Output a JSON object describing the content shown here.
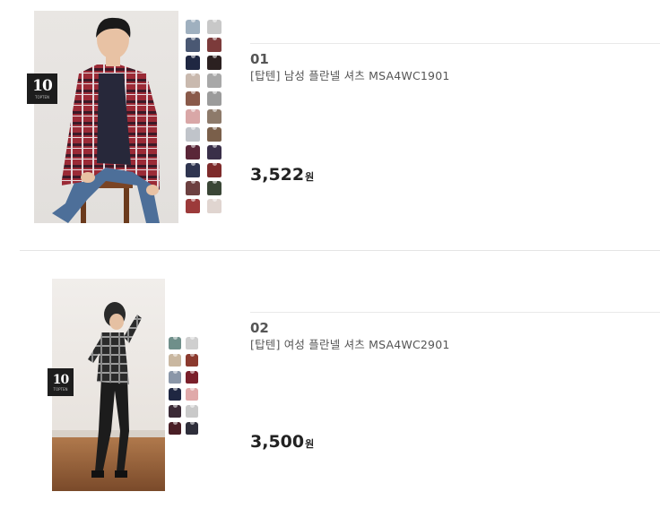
{
  "products": [
    {
      "rank": "01",
      "title": "[탑텐] 남성 플란넬 셔츠 MSA4WC1901",
      "price": "3,522",
      "currency": "원",
      "badge": {
        "number": "10",
        "sub": "TOPTEN"
      },
      "swatch_colors": [
        "#9fb0bf",
        "#c8c8c8",
        "#4a5873",
        "#7c3b3b",
        "#1f2742",
        "#2b2020",
        "#c9b9ae",
        "#a8a8a8",
        "#8a5a4a",
        "#9b9b9b",
        "#d9a7a7",
        "#8d7a6a",
        "#c0c4ca",
        "#7a5f4a",
        "#5a2638",
        "#3a2f49",
        "#2f3550",
        "#7e2b2b",
        "#6c4040",
        "#3a4636",
        "#9c3a3a",
        "#e0d5d0"
      ]
    },
    {
      "rank": "02",
      "title": "[탑텐] 여성 플란넬 셔츠 MSA4WC2901",
      "price": "3,500",
      "currency": "원",
      "badge": {
        "number": "10",
        "sub": "TOPTEN"
      },
      "swatch_colors": [
        "#6f8f8a",
        "#cfcfcf",
        "#c9b7a0",
        "#8b3a2e",
        "#8a96a8",
        "#7a1f2a",
        "#1f2742",
        "#e0a9a9",
        "#3b2a36",
        "#c9c9c9",
        "#4a1f26",
        "#2e2e3a"
      ]
    }
  ]
}
